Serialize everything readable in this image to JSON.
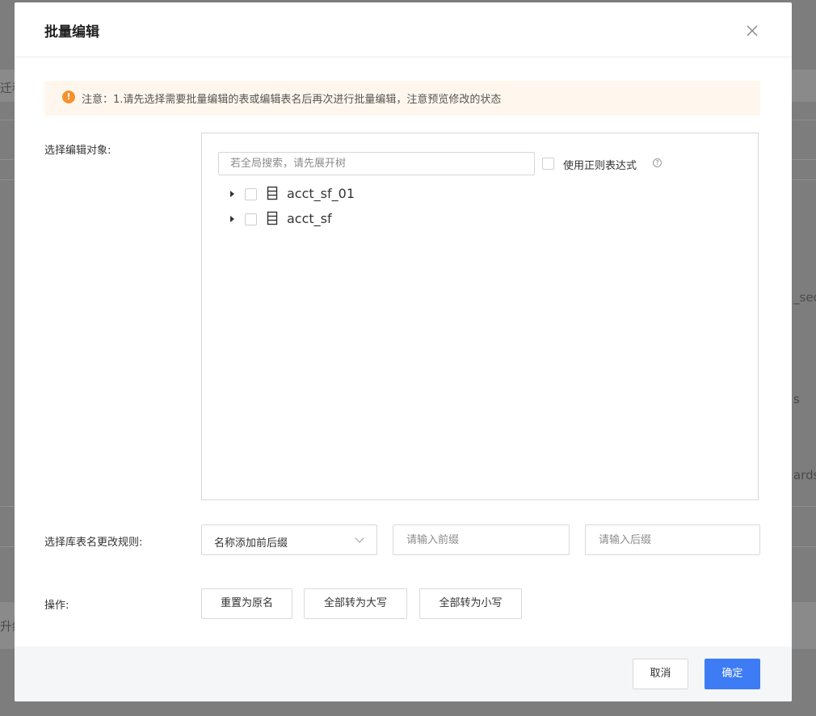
{
  "background": {
    "fragments": [
      "迁移",
      "_sec",
      "s",
      "ards",
      "升级"
    ]
  },
  "modal": {
    "title": "批量编辑",
    "close_icon": "close-icon"
  },
  "notice": {
    "icon": "exclamation-circle-icon",
    "text": "注意：1.请先选择需要批量编辑的表或编辑表名后再次进行批量编辑，注意预览修改的状态",
    "accent_color": "#f5922f"
  },
  "target": {
    "label": "选择编辑对象:",
    "search_placeholder": "若全局搜索，请先展开树",
    "regex_label": "使用正则表达式",
    "help_icon": "question-circle-icon",
    "tree": [
      {
        "label": "acct_sf_01",
        "icon": "database-icon",
        "checked": false,
        "expanded": false
      },
      {
        "label": "acct_sf",
        "icon": "database-icon",
        "checked": false,
        "expanded": false
      }
    ]
  },
  "rule": {
    "label": "选择库表名更改规则:",
    "select_value": "名称添加前后缀",
    "prefix_placeholder": "请输入前缀",
    "suffix_placeholder": "请输入后缀"
  },
  "operations": {
    "label": "操作:",
    "reset": "重置为原名",
    "upper": "全部转为大写",
    "lower": "全部转为小写"
  },
  "footer": {
    "cancel": "取消",
    "ok": "确定",
    "primary_color": "#3d7cf5"
  }
}
